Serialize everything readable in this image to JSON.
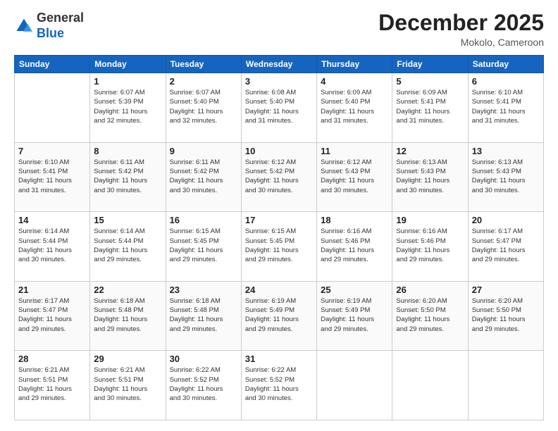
{
  "header": {
    "logo": {
      "line1": "General",
      "line2": "Blue"
    },
    "title": "December 2025",
    "subtitle": "Mokolo, Cameroon"
  },
  "calendar": {
    "days_of_week": [
      "Sunday",
      "Monday",
      "Tuesday",
      "Wednesday",
      "Thursday",
      "Friday",
      "Saturday"
    ],
    "weeks": [
      [
        {
          "day": "",
          "info": ""
        },
        {
          "day": "1",
          "info": "Sunrise: 6:07 AM\nSunset: 5:39 PM\nDaylight: 11 hours\nand 32 minutes."
        },
        {
          "day": "2",
          "info": "Sunrise: 6:07 AM\nSunset: 5:40 PM\nDaylight: 11 hours\nand 32 minutes."
        },
        {
          "day": "3",
          "info": "Sunrise: 6:08 AM\nSunset: 5:40 PM\nDaylight: 11 hours\nand 31 minutes."
        },
        {
          "day": "4",
          "info": "Sunrise: 6:09 AM\nSunset: 5:40 PM\nDaylight: 11 hours\nand 31 minutes."
        },
        {
          "day": "5",
          "info": "Sunrise: 6:09 AM\nSunset: 5:41 PM\nDaylight: 11 hours\nand 31 minutes."
        },
        {
          "day": "6",
          "info": "Sunrise: 6:10 AM\nSunset: 5:41 PM\nDaylight: 11 hours\nand 31 minutes."
        }
      ],
      [
        {
          "day": "7",
          "info": "Sunrise: 6:10 AM\nSunset: 5:41 PM\nDaylight: 11 hours\nand 31 minutes."
        },
        {
          "day": "8",
          "info": "Sunrise: 6:11 AM\nSunset: 5:42 PM\nDaylight: 11 hours\nand 30 minutes."
        },
        {
          "day": "9",
          "info": "Sunrise: 6:11 AM\nSunset: 5:42 PM\nDaylight: 11 hours\nand 30 minutes."
        },
        {
          "day": "10",
          "info": "Sunrise: 6:12 AM\nSunset: 5:42 PM\nDaylight: 11 hours\nand 30 minutes."
        },
        {
          "day": "11",
          "info": "Sunrise: 6:12 AM\nSunset: 5:43 PM\nDaylight: 11 hours\nand 30 minutes."
        },
        {
          "day": "12",
          "info": "Sunrise: 6:13 AM\nSunset: 5:43 PM\nDaylight: 11 hours\nand 30 minutes."
        },
        {
          "day": "13",
          "info": "Sunrise: 6:13 AM\nSunset: 5:43 PM\nDaylight: 11 hours\nand 30 minutes."
        }
      ],
      [
        {
          "day": "14",
          "info": "Sunrise: 6:14 AM\nSunset: 5:44 PM\nDaylight: 11 hours\nand 30 minutes."
        },
        {
          "day": "15",
          "info": "Sunrise: 6:14 AM\nSunset: 5:44 PM\nDaylight: 11 hours\nand 29 minutes."
        },
        {
          "day": "16",
          "info": "Sunrise: 6:15 AM\nSunset: 5:45 PM\nDaylight: 11 hours\nand 29 minutes."
        },
        {
          "day": "17",
          "info": "Sunrise: 6:15 AM\nSunset: 5:45 PM\nDaylight: 11 hours\nand 29 minutes."
        },
        {
          "day": "18",
          "info": "Sunrise: 6:16 AM\nSunset: 5:46 PM\nDaylight: 11 hours\nand 29 minutes."
        },
        {
          "day": "19",
          "info": "Sunrise: 6:16 AM\nSunset: 5:46 PM\nDaylight: 11 hours\nand 29 minutes."
        },
        {
          "day": "20",
          "info": "Sunrise: 6:17 AM\nSunset: 5:47 PM\nDaylight: 11 hours\nand 29 minutes."
        }
      ],
      [
        {
          "day": "21",
          "info": "Sunrise: 6:17 AM\nSunset: 5:47 PM\nDaylight: 11 hours\nand 29 minutes."
        },
        {
          "day": "22",
          "info": "Sunrise: 6:18 AM\nSunset: 5:48 PM\nDaylight: 11 hours\nand 29 minutes."
        },
        {
          "day": "23",
          "info": "Sunrise: 6:18 AM\nSunset: 5:48 PM\nDaylight: 11 hours\nand 29 minutes."
        },
        {
          "day": "24",
          "info": "Sunrise: 6:19 AM\nSunset: 5:49 PM\nDaylight: 11 hours\nand 29 minutes."
        },
        {
          "day": "25",
          "info": "Sunrise: 6:19 AM\nSunset: 5:49 PM\nDaylight: 11 hours\nand 29 minutes."
        },
        {
          "day": "26",
          "info": "Sunrise: 6:20 AM\nSunset: 5:50 PM\nDaylight: 11 hours\nand 29 minutes."
        },
        {
          "day": "27",
          "info": "Sunrise: 6:20 AM\nSunset: 5:50 PM\nDaylight: 11 hours\nand 29 minutes."
        }
      ],
      [
        {
          "day": "28",
          "info": "Sunrise: 6:21 AM\nSunset: 5:51 PM\nDaylight: 11 hours\nand 29 minutes."
        },
        {
          "day": "29",
          "info": "Sunrise: 6:21 AM\nSunset: 5:51 PM\nDaylight: 11 hours\nand 30 minutes."
        },
        {
          "day": "30",
          "info": "Sunrise: 6:22 AM\nSunset: 5:52 PM\nDaylight: 11 hours\nand 30 minutes."
        },
        {
          "day": "31",
          "info": "Sunrise: 6:22 AM\nSunset: 5:52 PM\nDaylight: 11 hours\nand 30 minutes."
        },
        {
          "day": "",
          "info": ""
        },
        {
          "day": "",
          "info": ""
        },
        {
          "day": "",
          "info": ""
        }
      ]
    ]
  }
}
